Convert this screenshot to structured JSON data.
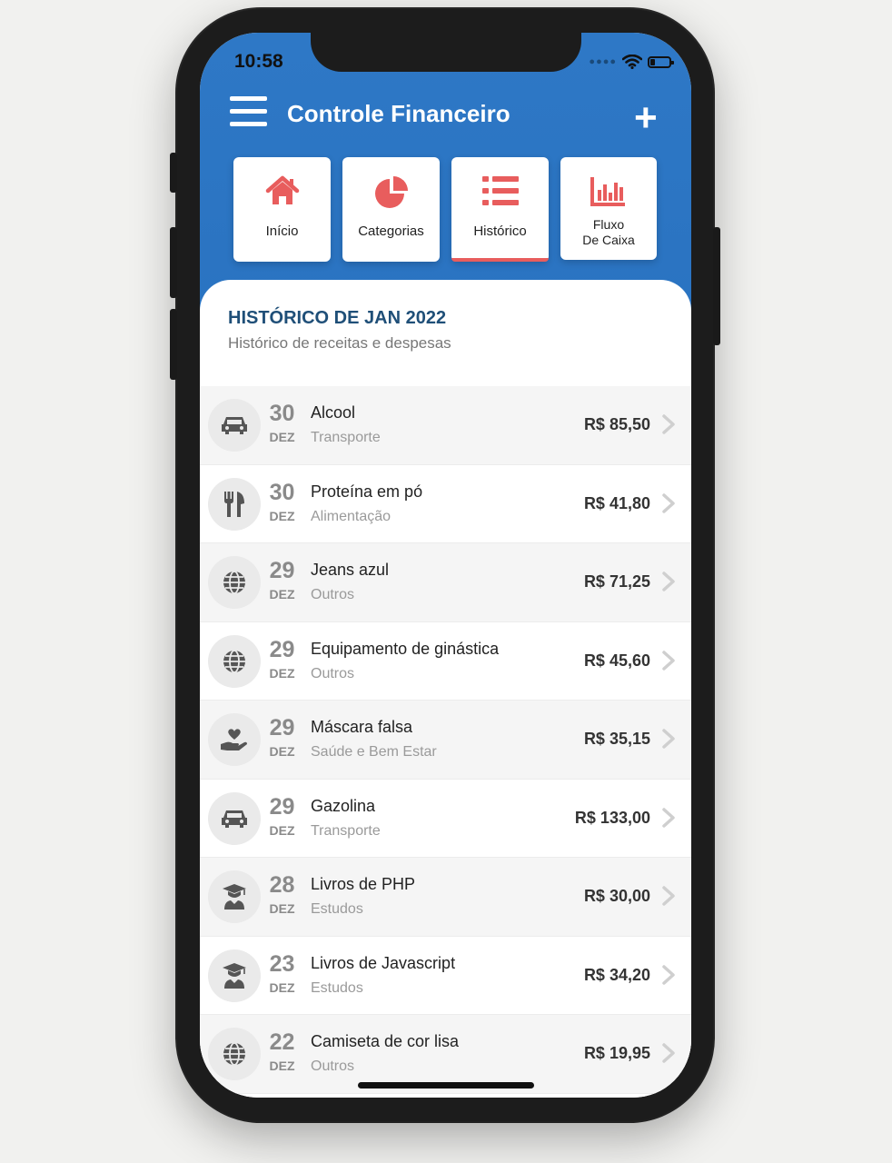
{
  "status": {
    "time": "10:58"
  },
  "header": {
    "title": "Controle Financeiro"
  },
  "tabs": [
    {
      "label": "Início",
      "icon": "home-icon"
    },
    {
      "label": "Categorias",
      "icon": "pie-chart-icon"
    },
    {
      "label": "Histórico",
      "icon": "list-icon"
    },
    {
      "label_line1": "Fluxo",
      "label_line2": "De Caixa",
      "icon": "bar-chart-icon"
    }
  ],
  "history": {
    "title": "HISTÓRICO DE JAN 2022",
    "subtitle": "Histórico de receitas e despesas"
  },
  "transactions": [
    {
      "day": "30",
      "month": "DEZ",
      "description": "Alcool",
      "category": "Transporte",
      "amount": "R$  85,50",
      "icon": "car-icon"
    },
    {
      "day": "30",
      "month": "DEZ",
      "description": "Proteína em pó",
      "category": "Alimentação",
      "amount": "R$  41,80",
      "icon": "utensils-icon"
    },
    {
      "day": "29",
      "month": "DEZ",
      "description": "Jeans azul",
      "category": "Outros",
      "amount": "R$  71,25",
      "icon": "globe-icon"
    },
    {
      "day": "29",
      "month": "DEZ",
      "description": "Equipamento de ginástica",
      "category": "Outros",
      "amount": "R$  45,60",
      "icon": "globe-icon"
    },
    {
      "day": "29",
      "month": "DEZ",
      "description": "Máscara falsa",
      "category": "Saúde e Bem Estar",
      "amount": "R$  35,15",
      "icon": "hand-heart-icon"
    },
    {
      "day": "29",
      "month": "DEZ",
      "description": "Gazolina",
      "category": "Transporte",
      "amount": "R$  133,00",
      "icon": "car-icon"
    },
    {
      "day": "28",
      "month": "DEZ",
      "description": "Livros de PHP",
      "category": "Estudos",
      "amount": "R$  30,00",
      "icon": "graduate-icon"
    },
    {
      "day": "23",
      "month": "DEZ",
      "description": "Livros de Javascript",
      "category": "Estudos",
      "amount": "R$  34,20",
      "icon": "graduate-icon"
    },
    {
      "day": "22",
      "month": "DEZ",
      "description": "Camiseta de cor lisa",
      "category": "Outros",
      "amount": "R$  19,95",
      "icon": "globe-icon"
    }
  ],
  "colors": {
    "header_blue": "#2e78c6",
    "accent_red": "#e85d5d",
    "title_blue": "#1f4f78"
  }
}
